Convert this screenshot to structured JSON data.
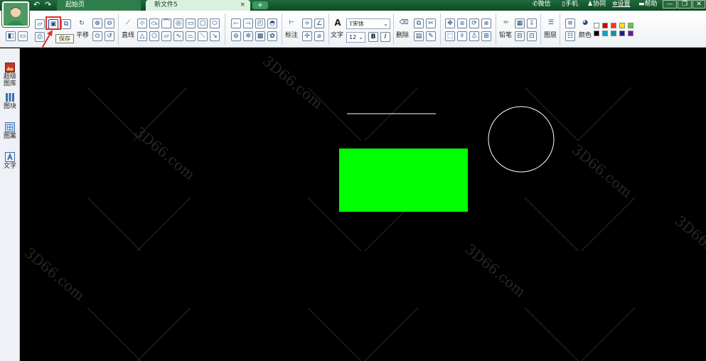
{
  "app": {
    "tabs": [
      {
        "label": "起始页",
        "active": false
      },
      {
        "label": "新文件5",
        "active": true
      }
    ],
    "new_tab": "+",
    "close_glyph": "×",
    "top_links": [
      "微信",
      "手机",
      "协同",
      "设置",
      "帮助"
    ]
  },
  "toolbar": {
    "pan_label": "平移",
    "line_label": "直线",
    "dimension_label": "标注",
    "text_label": "文字",
    "font_name": "宋体",
    "font_size": "12",
    "bold": "B",
    "italic": "I",
    "delete_label": "删除",
    "pencil_label": "铅笔",
    "layer_label": "图层",
    "color_label": "颜色",
    "tooltip": "保存",
    "swatches": [
      "#ffffff",
      "#d40000",
      "#ff3b1f",
      "#ffe800",
      "#66cc33",
      "#000000",
      "#00a6d6",
      "#009999",
      "#1a237e",
      "#6a1b9a"
    ]
  },
  "sidebar": {
    "items": [
      {
        "label_line1": "超级",
        "label_line2": "图库",
        "icon": "gallery-icon"
      },
      {
        "label_line1": "图块",
        "label_line2": "",
        "icon": "block-icon"
      },
      {
        "label_line1": "图案",
        "label_line2": "",
        "icon": "pattern-icon"
      },
      {
        "label_line1": "文字",
        "label_line2": "",
        "icon": "text-icon"
      }
    ]
  },
  "canvas": {
    "background": "#000000",
    "line_color": "#ffffff",
    "rect_fill": "#00ff00",
    "circle_stroke": "#ffffff",
    "watermark": "3D66.com"
  },
  "colors": {
    "titlebar": "#1f6b3c",
    "highlight": "#e0302a"
  }
}
